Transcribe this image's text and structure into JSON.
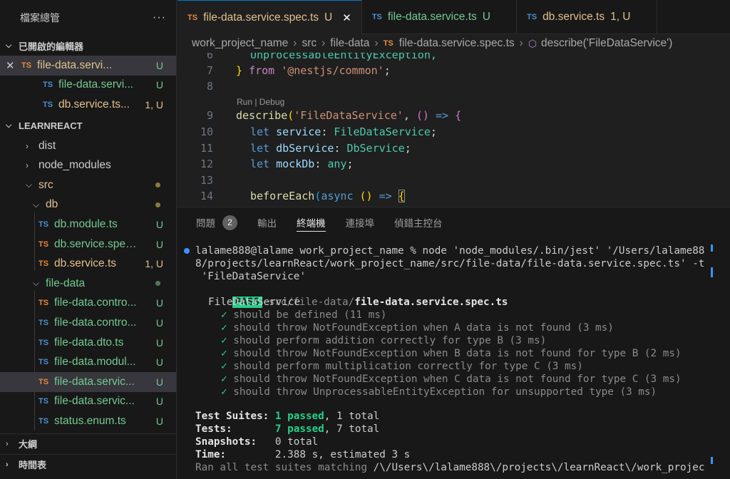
{
  "sidebar": {
    "title": "檔案總管",
    "more": "···",
    "open_editors": {
      "label": "已開啟的編輯器",
      "items": [
        {
          "icon": "TS",
          "name": "file-data.servi...",
          "status": "U"
        },
        {
          "icon": "TS",
          "name": "file-data.servi...",
          "status": "U"
        },
        {
          "icon": "TS",
          "name": "db.service.ts...",
          "status": "1, U"
        }
      ]
    },
    "project": {
      "label": "LEARNREACT",
      "items": [
        {
          "name": "dist"
        },
        {
          "name": "node_modules"
        },
        {
          "name": "src"
        },
        {
          "name": "db"
        },
        {
          "icon": "TS",
          "name": "db.module.ts",
          "status": "U"
        },
        {
          "icon": "TS",
          "name": "db.service.spec....",
          "status": "U"
        },
        {
          "icon": "TS",
          "name": "db.service.ts",
          "status": "1, U"
        },
        {
          "name": "file-data"
        },
        {
          "icon": "TS",
          "name": "file-data.contro...",
          "status": "U"
        },
        {
          "icon": "TS",
          "name": "file-data.contro...",
          "status": "U"
        },
        {
          "icon": "TS",
          "name": "file-data.dto.ts",
          "status": "U"
        },
        {
          "icon": "TS",
          "name": "file-data.modul...",
          "status": "U"
        },
        {
          "icon": "TS",
          "name": "file-data.servic...",
          "status": "U"
        },
        {
          "icon": "TS",
          "name": "file-data.servic...",
          "status": "U"
        },
        {
          "icon": "TS",
          "name": "status.enum.ts",
          "status": "U"
        }
      ]
    },
    "outline": "大綱",
    "timeline": "時間表"
  },
  "tabs": [
    {
      "icon": "TS",
      "name": "file-data.service.spec.ts",
      "status": "U",
      "close": "✕"
    },
    {
      "icon": "TS",
      "name": "file-data.service.ts",
      "status": "U"
    },
    {
      "icon": "TS",
      "name": "db.service.ts",
      "status": "1, U"
    }
  ],
  "breadcrumb": {
    "parts": [
      "work_project_name",
      "src",
      "file-data"
    ],
    "file_icon": "TS",
    "file": "file-data.service.spec.ts",
    "symbol": "describe('FileDataService')"
  },
  "editor": {
    "codelens": "Run | Debug",
    "line_numbers": [
      "6",
      "7",
      "8",
      "9",
      "10",
      "11",
      "12",
      "13",
      "14"
    ],
    "lines": {
      "l6": "UnprocessableEntityException,",
      "l7_from": "from",
      "l7_str": "'@nestjs/common'",
      "l9_fn": "describe",
      "l9_str": "'FileDataService'",
      "l10_kw": "let",
      "l10_var": "service",
      "l10_type": "FileDataService",
      "l11_kw": "let",
      "l11_var": "dbService",
      "l11_type": "DbService",
      "l12_kw": "let",
      "l12_var": "mockDb",
      "l12_type": "any",
      "l14_fn": "beforeEach",
      "l14_kw": "async"
    }
  },
  "panel": {
    "tabs": [
      "問題",
      "輸出",
      "終端機",
      "連接埠",
      "偵錯主控台"
    ],
    "problems_count": "2",
    "active_tab": "終端機"
  },
  "terminal": {
    "cmd1": "lalame888@lalame work_project_name % node 'node_modules/.bin/jest' '/Users/lalame88",
    "cmd2": "8/projects/learnReact/work_project_name/src/file-data/file-data.service.spec.ts' -t",
    "cmd3": " 'FileDataService'",
    "pass": "PASS",
    "path_dim": "src/file-data/",
    "path_bold": "file-data.service.spec.ts",
    "suite": "FileDataService",
    "tests": [
      "should be defined (11 ms)",
      "should throw NotFoundException when A data is not found (3 ms)",
      "should perform addition correctly for type B (3 ms)",
      "should throw NotFoundException when B data is not found for type B (2 ms)",
      "should perform multiplication correctly for type C (3 ms)",
      "should throw NotFoundException when C data is not found for type C (3 ms)",
      "should throw UnprocessableEntityException for unsupported type (3 ms)"
    ],
    "summary": {
      "suites_label": "Test Suites:",
      "suites_passed": "1 passed",
      "suites_total": ", 1 total",
      "tests_label": "Tests:",
      "tests_passed": "7 passed",
      "tests_total": ", 7 total",
      "snap_label": "Snapshots:",
      "snap_value": "0 total",
      "time_label": "Time:",
      "time_value": "2.388 s, estimated 3 s"
    },
    "last_dim": "Ran all test suites matching ",
    "last_path": "/\\/Users\\/lalame888\\/projects\\/learnReact\\/work_projec"
  },
  "colors": {
    "accent": "#0078d4",
    "pass_bg": "#23d18b",
    "untracked": "#73c991",
    "modified": "#e2c08d"
  }
}
